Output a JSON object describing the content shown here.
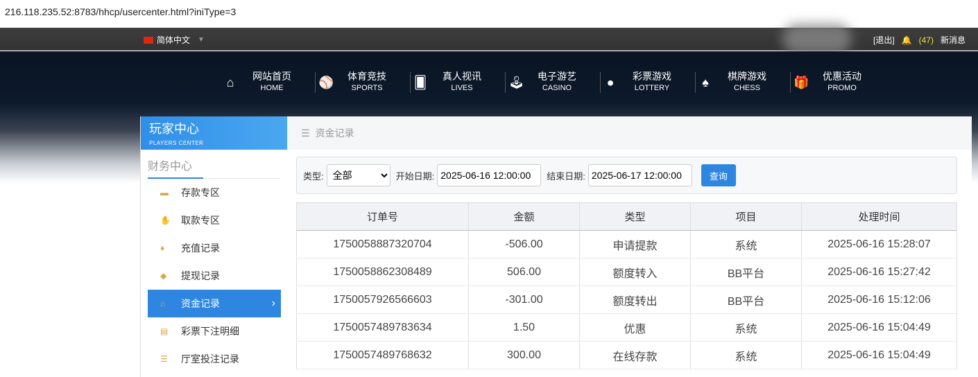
{
  "url": "216.118.235.52:8783/hhcp/usercenter.html?iniType=3",
  "topbar": {
    "language": "简体中文",
    "logout": "[退出]",
    "message_count": "(47)",
    "messages": "新消息"
  },
  "nav": [
    {
      "icon": "home-icon",
      "glyph": "⌂",
      "label": "网站首页",
      "sub": "HOME"
    },
    {
      "icon": "ball-icon",
      "glyph": "⚾",
      "label": "体育竞技",
      "sub": "SPORTS"
    },
    {
      "icon": "cards-icon",
      "glyph": "🂠",
      "label": "真人视讯",
      "sub": "LIVES"
    },
    {
      "icon": "joystick-icon",
      "glyph": "🕹",
      "label": "电子游艺",
      "sub": "CASINO"
    },
    {
      "icon": "lottery-balls-icon",
      "glyph": "●",
      "label": "彩票游戏",
      "sub": "LOTTERY"
    },
    {
      "icon": "spade-icon",
      "glyph": "♠",
      "label": "棋牌游戏",
      "sub": "CHESS"
    },
    {
      "icon": "gift-icon",
      "glyph": "🎁",
      "label": "优惠活动",
      "sub": "PROMO"
    }
  ],
  "sidebar": {
    "title": "玩家中心",
    "subtitle": "PLAYERS CENTER",
    "section": "财务中心",
    "items": [
      {
        "icon": "card-icon",
        "glyph": "▬",
        "label": "存款专区"
      },
      {
        "icon": "hand-money-icon",
        "glyph": "✋",
        "label": "取款专区"
      },
      {
        "icon": "money-bag-icon",
        "glyph": "♦",
        "label": "充值记录"
      },
      {
        "icon": "wallet-icon",
        "glyph": "◆",
        "label": "提现记录"
      },
      {
        "icon": "house-icon",
        "glyph": "⌂",
        "label": "资金记录",
        "active": true
      },
      {
        "icon": "list-icon",
        "glyph": "▤",
        "label": "彩票下注明细"
      },
      {
        "icon": "list-bullets-icon",
        "glyph": "☰",
        "label": "厅室投注记录"
      }
    ]
  },
  "breadcrumb": "资金记录",
  "filter": {
    "type_label": "类型:",
    "type_value": "全部",
    "start_label": "开始日期:",
    "start_value": "2025-06-16 12:00:00",
    "end_label": "结束日期:",
    "end_value": "2025-06-17 12:00:00",
    "query": "查询"
  },
  "table": {
    "columns": [
      "订单号",
      "金额",
      "类型",
      "项目",
      "处理时间"
    ],
    "rows": [
      [
        "1750058887320704",
        "-506.00",
        "申请提款",
        "系统",
        "2025-06-16 15:28:07"
      ],
      [
        "1750058862308489",
        "506.00",
        "额度转入",
        "BB平台",
        "2025-06-16 15:27:42"
      ],
      [
        "1750057926566603",
        "-301.00",
        "额度转出",
        "BB平台",
        "2025-06-16 15:12:06"
      ],
      [
        "1750057489783634",
        "1.50",
        "优惠",
        "系统",
        "2025-06-16 15:04:49"
      ],
      [
        "1750057489768632",
        "300.00",
        "在线存款",
        "系统",
        "2025-06-16 15:04:49"
      ]
    ]
  },
  "colors": {
    "accent": "#2e86e0"
  }
}
